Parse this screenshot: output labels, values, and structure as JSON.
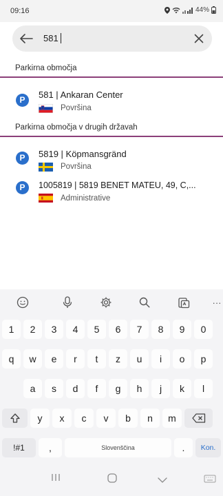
{
  "status": {
    "time": "09:16",
    "battery": "44%"
  },
  "search": {
    "query": "581"
  },
  "sections": [
    {
      "title": "Parkirna območja"
    },
    {
      "title": "Parkirna območja v drugih državah"
    }
  ],
  "results": [
    {
      "badge": "P",
      "title": "581 | Ankaran Center",
      "subtitle": "Površina",
      "flag": "si"
    },
    {
      "badge": "P",
      "title": "5819 | Köpmansgränd",
      "subtitle": "Površina",
      "flag": "se"
    },
    {
      "badge": "P",
      "title": "1005819 | 5819 BENET MATEU, 49, C,...",
      "subtitle": "Administrative",
      "flag": "es"
    }
  ],
  "keyboard": {
    "row1": [
      "1",
      "2",
      "3",
      "4",
      "5",
      "6",
      "7",
      "8",
      "9",
      "0"
    ],
    "row2": [
      "q",
      "w",
      "e",
      "r",
      "t",
      "z",
      "u",
      "i",
      "o",
      "p"
    ],
    "row3": [
      "a",
      "s",
      "d",
      "f",
      "g",
      "h",
      "j",
      "k",
      "l"
    ],
    "row4": [
      "y",
      "x",
      "c",
      "v",
      "b",
      "n",
      "m"
    ],
    "symbols_label": "!#1",
    "comma": ",",
    "space_label": "Slovenščina",
    "period": ".",
    "enter_label": "Kon."
  },
  "toolbar_more": "···",
  "colors": {
    "accent": "#2a6fcb",
    "section_rule": "#8b3f79"
  }
}
